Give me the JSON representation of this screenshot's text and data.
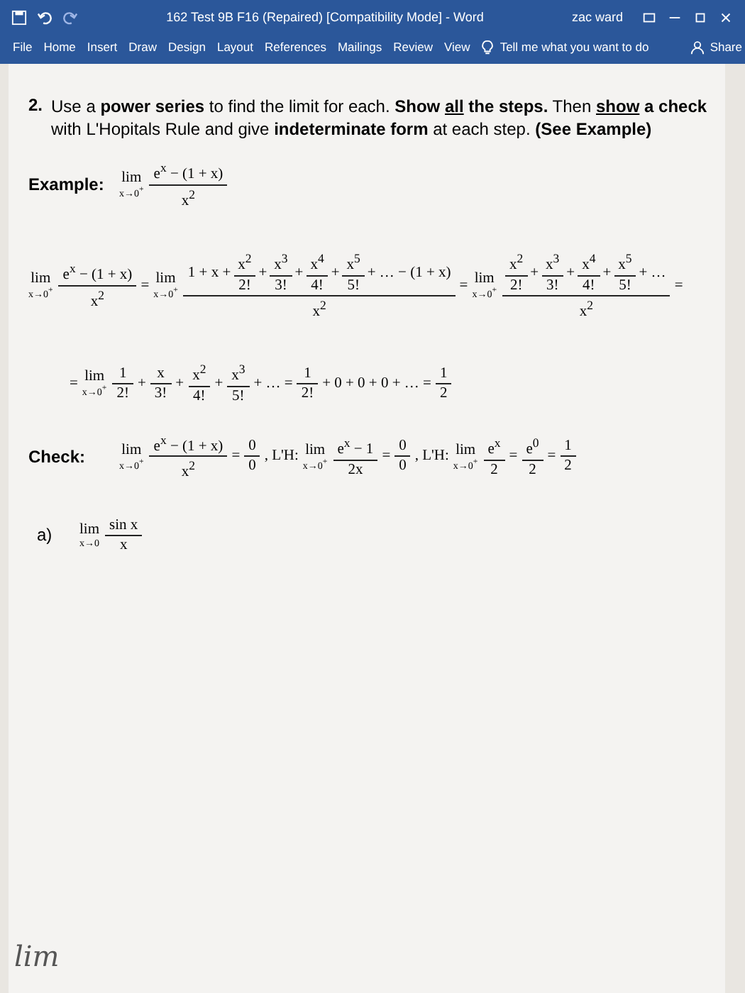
{
  "window": {
    "title": "162 Test 9B F16 (Repaired) [Compatibility Mode] - Word",
    "user": "zac ward"
  },
  "tabs": [
    {
      "label": "File",
      "selected": false
    },
    {
      "label": "Home",
      "selected": false
    },
    {
      "label": "Insert",
      "selected": false
    },
    {
      "label": "Draw",
      "selected": false
    },
    {
      "label": "Design",
      "selected": false
    },
    {
      "label": "Layout",
      "selected": false
    },
    {
      "label": "References",
      "selected": false
    },
    {
      "label": "Mailings",
      "selected": false
    },
    {
      "label": "Review",
      "selected": false
    },
    {
      "label": "View",
      "selected": false
    }
  ],
  "tell_me": {
    "placeholder": "Tell me what you want to do"
  },
  "share": {
    "label": "Share"
  },
  "document": {
    "problem": {
      "number": "2.",
      "segments": [
        {
          "t": "Use a ",
          "bold": false,
          "underline": false
        },
        {
          "t": "power series",
          "bold": true,
          "underline": false
        },
        {
          "t": " to find the limit for each. ",
          "bold": false,
          "underline": false
        },
        {
          "t": "Show ",
          "bold": true,
          "underline": false
        },
        {
          "t": "all",
          "bold": true,
          "underline": true
        },
        {
          "t": " the steps.",
          "bold": true,
          "underline": false
        },
        {
          "t": " Then ",
          "bold": false,
          "underline": false
        },
        {
          "t": "show",
          "bold": true,
          "underline": true
        },
        {
          "t": " a check",
          "bold": true,
          "underline": false
        },
        {
          "t": " with L'Hopitals Rule and give ",
          "bold": false,
          "underline": false
        },
        {
          "t": "indeterminate form",
          "bold": true,
          "underline": false
        },
        {
          "t": " at each step. ",
          "bold": false,
          "underline": false
        },
        {
          "t": "(See Example)",
          "bold": true,
          "underline": false
        }
      ]
    },
    "example": {
      "label": "Example:",
      "tokens": [
        {
          "kind": "lim",
          "word": "lim",
          "under": "x→0$^{+}$"
        },
        {
          "kind": "frac",
          "num": [
            {
              "kind": "text",
              "t": "e$^{x}$ − (1 + x)"
            }
          ],
          "den": [
            {
              "kind": "text",
              "t": "x$^{2}$"
            }
          ]
        }
      ]
    },
    "steps": [
      [
        {
          "kind": "lim",
          "word": "lim",
          "under": "x→0$^{+}$"
        },
        {
          "kind": "frac",
          "num": [
            {
              "kind": "text",
              "t": "e$^{x}$ − (1 + x)"
            }
          ],
          "den": [
            {
              "kind": "text",
              "t": "x$^{2}$"
            }
          ]
        },
        {
          "kind": "text",
          "t": "="
        },
        {
          "kind": "lim",
          "word": "lim",
          "under": "x→0$^{+}$"
        },
        {
          "kind": "frac",
          "num": [
            {
              "kind": "text",
              "t": "1 + x +"
            },
            {
              "kind": "frac",
              "num": [
                {
                  "kind": "text",
                  "t": "x$^{2}$"
                }
              ],
              "den": [
                {
                  "kind": "text",
                  "t": "2!"
                }
              ]
            },
            {
              "kind": "text",
              "t": "+"
            },
            {
              "kind": "frac",
              "num": [
                {
                  "kind": "text",
                  "t": "x$^{3}$"
                }
              ],
              "den": [
                {
                  "kind": "text",
                  "t": "3!"
                }
              ]
            },
            {
              "kind": "text",
              "t": "+"
            },
            {
              "kind": "frac",
              "num": [
                {
                  "kind": "text",
                  "t": "x$^{4}$"
                }
              ],
              "den": [
                {
                  "kind": "text",
                  "t": "4!"
                }
              ]
            },
            {
              "kind": "text",
              "t": "+"
            },
            {
              "kind": "frac",
              "num": [
                {
                  "kind": "text",
                  "t": "x$^{5}$"
                }
              ],
              "den": [
                {
                  "kind": "text",
                  "t": "5!"
                }
              ]
            },
            {
              "kind": "text",
              "t": "+ … − (1 + x)"
            }
          ],
          "den": [
            {
              "kind": "text",
              "t": "x$^{2}$"
            }
          ]
        },
        {
          "kind": "text",
          "t": "="
        },
        {
          "kind": "lim",
          "word": "lim",
          "under": "x→0$^{+}$"
        },
        {
          "kind": "frac",
          "num": [
            {
              "kind": "frac",
              "num": [
                {
                  "kind": "text",
                  "t": "x$^{2}$"
                }
              ],
              "den": [
                {
                  "kind": "text",
                  "t": "2!"
                }
              ]
            },
            {
              "kind": "text",
              "t": "+"
            },
            {
              "kind": "frac",
              "num": [
                {
                  "kind": "text",
                  "t": "x$^{3}$"
                }
              ],
              "den": [
                {
                  "kind": "text",
                  "t": "3!"
                }
              ]
            },
            {
              "kind": "text",
              "t": "+"
            },
            {
              "kind": "frac",
              "num": [
                {
                  "kind": "text",
                  "t": "x$^{4}$"
                }
              ],
              "den": [
                {
                  "kind": "text",
                  "t": "4!"
                }
              ]
            },
            {
              "kind": "text",
              "t": "+"
            },
            {
              "kind": "frac",
              "num": [
                {
                  "kind": "text",
                  "t": "x$^{5}$"
                }
              ],
              "den": [
                {
                  "kind": "text",
                  "t": "5!"
                }
              ]
            },
            {
              "kind": "text",
              "t": "+ …"
            }
          ],
          "den": [
            {
              "kind": "text",
              "t": "x$^{2}$"
            }
          ]
        },
        {
          "kind": "text",
          "t": "="
        }
      ],
      [
        {
          "kind": "text",
          "t": "="
        },
        {
          "kind": "lim",
          "word": "lim",
          "under": "x→0$^{+}$"
        },
        {
          "kind": "frac",
          "num": [
            {
              "kind": "text",
              "t": "1"
            }
          ],
          "den": [
            {
              "kind": "text",
              "t": "2!"
            }
          ]
        },
        {
          "kind": "text",
          "t": "+"
        },
        {
          "kind": "frac",
          "num": [
            {
              "kind": "text",
              "t": "x"
            }
          ],
          "den": [
            {
              "kind": "text",
              "t": "3!"
            }
          ]
        },
        {
          "kind": "text",
          "t": "+"
        },
        {
          "kind": "frac",
          "num": [
            {
              "kind": "text",
              "t": "x$^{2}$"
            }
          ],
          "den": [
            {
              "kind": "text",
              "t": "4!"
            }
          ]
        },
        {
          "kind": "text",
          "t": "+"
        },
        {
          "kind": "frac",
          "num": [
            {
              "kind": "text",
              "t": "x$^{3}$"
            }
          ],
          "den": [
            {
              "kind": "text",
              "t": "5!"
            }
          ]
        },
        {
          "kind": "text",
          "t": "+ … ="
        },
        {
          "kind": "frac",
          "num": [
            {
              "kind": "text",
              "t": "1"
            }
          ],
          "den": [
            {
              "kind": "text",
              "t": "2!"
            }
          ]
        },
        {
          "kind": "text",
          "t": "+ 0 + 0 + 0 + … ="
        },
        {
          "kind": "frac",
          "num": [
            {
              "kind": "text",
              "t": "1"
            }
          ],
          "den": [
            {
              "kind": "text",
              "t": "2"
            }
          ]
        }
      ]
    ],
    "check": {
      "label": "Check:",
      "tokens": [
        {
          "kind": "lim",
          "word": "lim",
          "under": "x→0$^{+}$"
        },
        {
          "kind": "frac",
          "num": [
            {
              "kind": "text",
              "t": "e$^{x}$ − (1 + x)"
            }
          ],
          "den": [
            {
              "kind": "text",
              "t": "x$^{2}$"
            }
          ]
        },
        {
          "kind": "text",
          "t": "="
        },
        {
          "kind": "frac",
          "num": [
            {
              "kind": "text",
              "t": "0"
            }
          ],
          "den": [
            {
              "kind": "text",
              "t": "0"
            }
          ]
        },
        {
          "kind": "text",
          "t": ",  L'H:"
        },
        {
          "kind": "lim",
          "word": "lim",
          "under": "x→0$^{+}$"
        },
        {
          "kind": "frac",
          "num": [
            {
              "kind": "text",
              "t": "e$^{x}$ − 1"
            }
          ],
          "den": [
            {
              "kind": "text",
              "t": "2x"
            }
          ]
        },
        {
          "kind": "text",
          "t": "="
        },
        {
          "kind": "frac",
          "num": [
            {
              "kind": "text",
              "t": "0"
            }
          ],
          "den": [
            {
              "kind": "text",
              "t": "0"
            }
          ]
        },
        {
          "kind": "text",
          "t": ",  L'H:"
        },
        {
          "kind": "lim",
          "word": "lim",
          "under": "x→0$^{+}$"
        },
        {
          "kind": "frac",
          "num": [
            {
              "kind": "text",
              "t": "e$^{x}$"
            }
          ],
          "den": [
            {
              "kind": "text",
              "t": "2"
            }
          ]
        },
        {
          "kind": "text",
          "t": "="
        },
        {
          "kind": "frac",
          "num": [
            {
              "kind": "text",
              "t": "e$^{0}$"
            }
          ],
          "den": [
            {
              "kind": "text",
              "t": "2"
            }
          ]
        },
        {
          "kind": "text",
          "t": "="
        },
        {
          "kind": "frac",
          "num": [
            {
              "kind": "text",
              "t": "1"
            }
          ],
          "den": [
            {
              "kind": "text",
              "t": "2"
            }
          ]
        }
      ]
    },
    "part_a": {
      "label": "a)",
      "tokens": [
        {
          "kind": "lim",
          "word": "lim",
          "under": "x→0"
        },
        {
          "kind": "frac",
          "num": [
            {
              "kind": "text",
              "t": "sin x"
            }
          ],
          "den": [
            {
              "kind": "text",
              "t": "x"
            }
          ]
        }
      ]
    },
    "handwriting": "lim"
  }
}
